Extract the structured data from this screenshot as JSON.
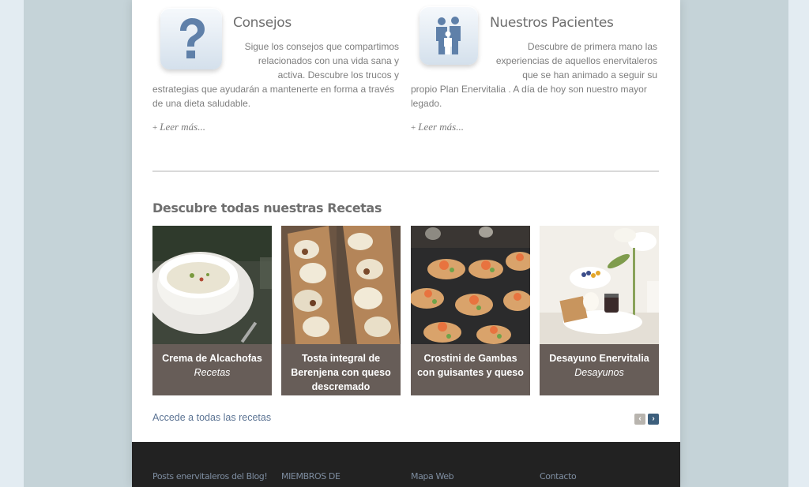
{
  "features": {
    "consejos": {
      "title": "Consejos",
      "text_right": "Sigue los consejos que compartimos relacionados con una vida sana y activa. Descubre los trucos y",
      "text_tail": "estrategias que ayudarán a mantenerte en forma a través de una dieta saludable.",
      "read_more": "Leer más...",
      "icon": "question-mark-icon"
    },
    "pacientes": {
      "title": "Nuestros Pacientes",
      "text_right": "Descubre de primera mano las experiencias de aquellos enervitaleros que se han animado a seguir su",
      "text_tail": "propio Plan Enervitalia . A día de hoy son nuestro mayor legado.",
      "read_more": "Leer más...",
      "icon": "family-icon"
    },
    "read_more_prefix": "+"
  },
  "recipes_section": {
    "title": "Descubre todas nuestras Recetas",
    "all_link": "Accede a todas las recetas",
    "prev_label": "‹",
    "next_label": "›",
    "cards": [
      {
        "name": "Crema de Alcachofas",
        "category": "Recetas"
      },
      {
        "name": "Tosta integral de Berenjena con queso descremado",
        "category": ""
      },
      {
        "name": "Crostini de Gambas con guisantes y queso",
        "category": ""
      },
      {
        "name": "Desayuno Enervitalia",
        "category": "Desayunos"
      }
    ]
  },
  "footer": {
    "links": [
      "Posts enervitaleros del Blog!",
      "MIEMBROS DE",
      "Mapa Web",
      "Contacto"
    ]
  },
  "colors": {
    "caption_bg": "#675d58",
    "link": "#5b7393",
    "footer_bg": "#222222"
  }
}
